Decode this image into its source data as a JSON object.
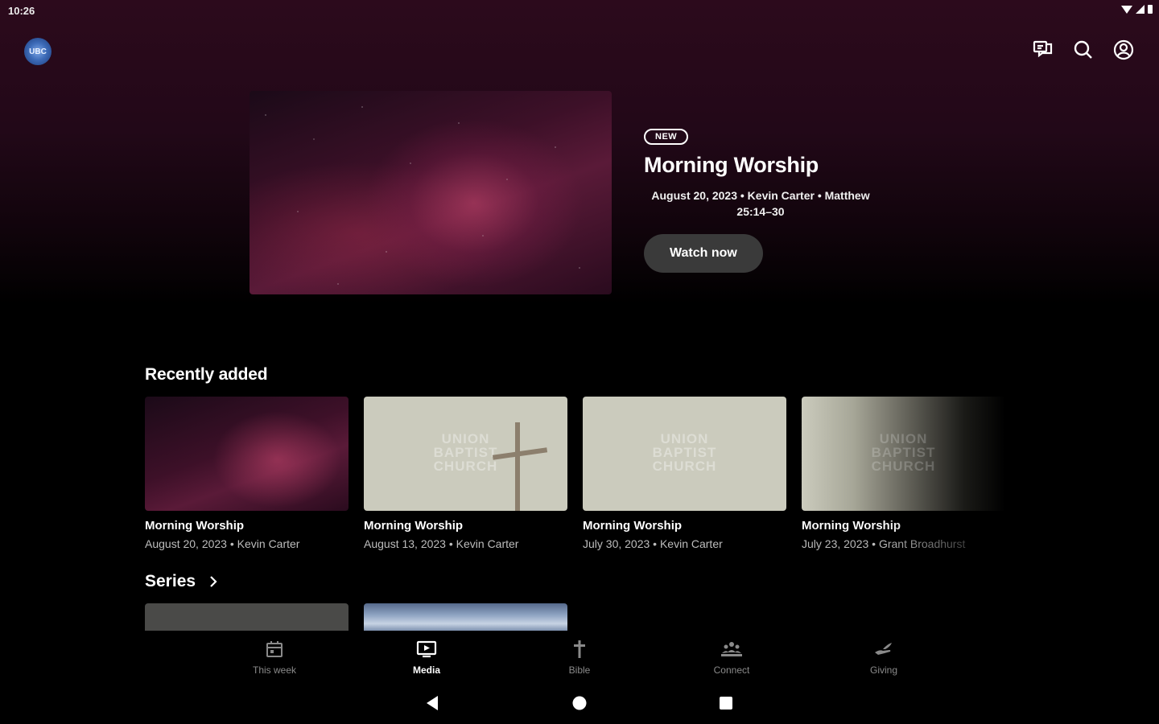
{
  "status_bar": {
    "time": "10:26"
  },
  "app": {
    "logo_text": "UBC"
  },
  "hero": {
    "badge": "NEW",
    "title": "Morning Worship",
    "meta": "August 20, 2023 • Kevin Carter • Matthew 25:14–30",
    "cta": "Watch now"
  },
  "recent": {
    "title": "Recently added",
    "items": [
      {
        "title": "Morning Worship",
        "meta": "August 20, 2023 • Kevin Carter"
      },
      {
        "title": "Morning Worship",
        "meta": "August 13, 2023 • Kevin Carter",
        "watermark": "UNION\nBAPTIST\nCHURCH"
      },
      {
        "title": "Morning Worship",
        "meta": "July 30, 2023 • Kevin Carter",
        "watermark": "UNION\nBAPTIST\nCHURCH"
      },
      {
        "title": "Morning Worship",
        "meta": "July 23, 2023 • Grant Broadhurst",
        "watermark": "UNION\nBAPTIST\nCHURCH"
      }
    ]
  },
  "series": {
    "title": "Series"
  },
  "bottom_nav": [
    {
      "label": "This week",
      "icon": "calendar-icon",
      "active": false
    },
    {
      "label": "Media",
      "icon": "media-icon",
      "active": true
    },
    {
      "label": "Bible",
      "icon": "cross-icon",
      "active": false
    },
    {
      "label": "Connect",
      "icon": "people-icon",
      "active": false
    },
    {
      "label": "Giving",
      "icon": "giving-icon",
      "active": false
    }
  ],
  "colors": {
    "background": "#000000",
    "hero_gradient_top": "#2c0a1c",
    "button_bg": "#3a3a3a",
    "muted_text": "#bdbdbd"
  }
}
